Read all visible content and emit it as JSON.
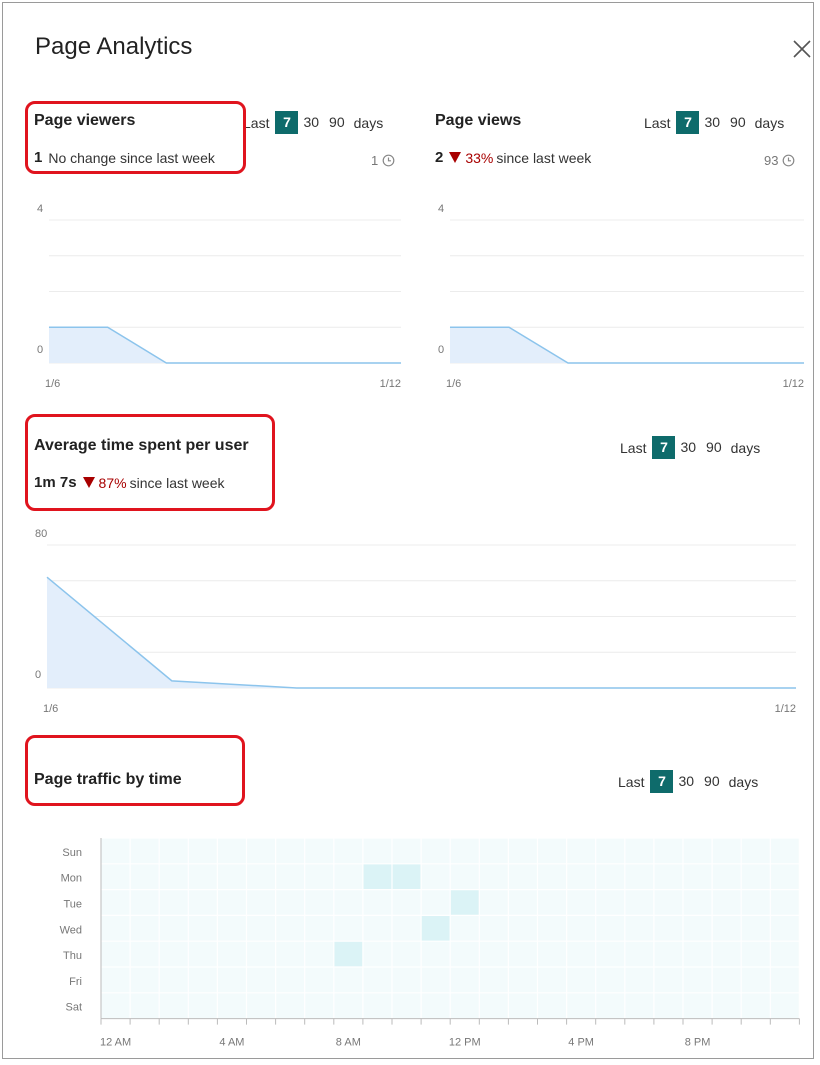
{
  "panel": {
    "title": "Page Analytics",
    "close_icon": "close-icon"
  },
  "period": {
    "last_label": "Last",
    "options": [
      "7",
      "30",
      "90"
    ],
    "selected": "7",
    "days_label": "days"
  },
  "page_viewers": {
    "title": "Page viewers",
    "value": "1",
    "change_text": "No change since last week",
    "count": "1",
    "chart_data": {
      "type": "area",
      "x": [
        "1/6",
        "1/7",
        "1/8",
        "1/9",
        "1/10",
        "1/11",
        "1/12"
      ],
      "y": [
        1,
        1,
        0,
        0,
        0,
        0,
        0
      ],
      "yticks": [
        "4",
        "0"
      ],
      "xlabels": [
        "1/6",
        "1/12"
      ],
      "ylim": [
        0,
        4
      ],
      "grid": true
    }
  },
  "page_views": {
    "title": "Page views",
    "value": "2",
    "change_pct": "33%",
    "change_text": "since last week",
    "count": "93",
    "chart_data": {
      "type": "area",
      "x": [
        "1/6",
        "1/7",
        "1/8",
        "1/9",
        "1/10",
        "1/11",
        "1/12"
      ],
      "y": [
        1,
        1,
        0,
        0,
        0,
        0,
        0
      ],
      "yticks": [
        "4",
        "0"
      ],
      "xlabels": [
        "1/6",
        "1/12"
      ],
      "ylim": [
        0,
        4
      ],
      "grid": true
    }
  },
  "avg_time": {
    "title": "Average time spent per user",
    "value": "1m 7s",
    "change_pct": "87%",
    "change_text": "since last week",
    "chart_data": {
      "type": "area",
      "x": [
        "1/6",
        "1/7",
        "1/8",
        "1/9",
        "1/10",
        "1/11",
        "1/12"
      ],
      "y": [
        62,
        4,
        0,
        0,
        0,
        0,
        0
      ],
      "yticks": [
        "80",
        "0"
      ],
      "xlabels": [
        "1/6",
        "1/12"
      ],
      "ylim": [
        0,
        80
      ],
      "grid": true
    }
  },
  "traffic": {
    "title": "Page traffic by time",
    "chart_data": {
      "type": "heatmap",
      "days": [
        "Sun",
        "Mon",
        "Tue",
        "Wed",
        "Thu",
        "Fri",
        "Sat"
      ],
      "hour_labels": [
        "12 AM",
        "4 AM",
        "8 AM",
        "12 PM",
        "4 PM",
        "8 PM"
      ],
      "hours": 24,
      "active_cells": [
        {
          "day": "Mon",
          "hour": 9
        },
        {
          "day": "Mon",
          "hour": 10
        },
        {
          "day": "Tue",
          "hour": 12
        },
        {
          "day": "Wed",
          "hour": 11
        },
        {
          "day": "Thu",
          "hour": 8
        }
      ]
    }
  },
  "colors": {
    "accent": "#0e6b6b",
    "negative": "#a80000",
    "highlight": "#e0141e",
    "series": "#8cc4ec",
    "fill": "#e3eefb",
    "heat_bg": "#f3fbfc",
    "heat_active": "#dbf3f6"
  }
}
